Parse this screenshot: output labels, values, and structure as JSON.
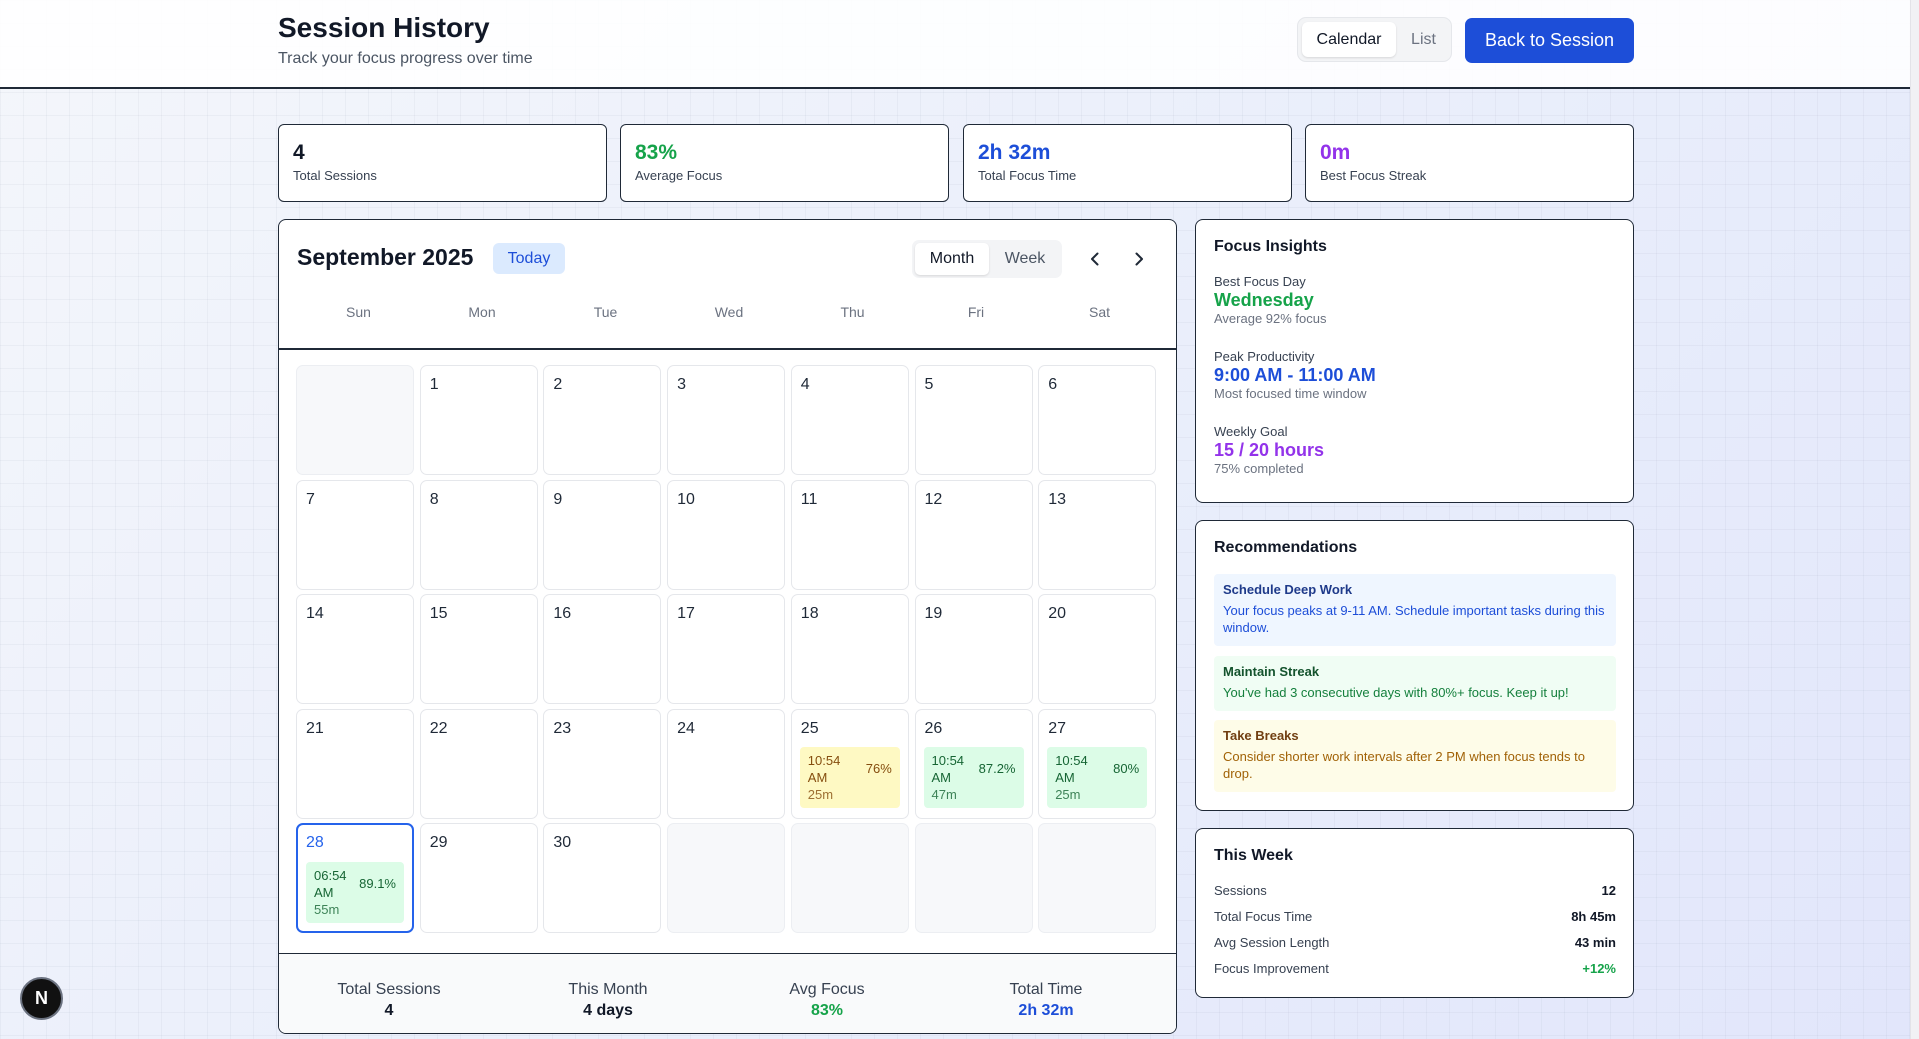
{
  "header": {
    "title": "Session History",
    "subtitle": "Track your focus progress over time",
    "view_toggle": {
      "calendar": "Calendar",
      "list": "List"
    },
    "back_button": "Back to Session"
  },
  "stats": [
    {
      "value": "4",
      "label": "Total Sessions",
      "color": "#111827"
    },
    {
      "value": "83%",
      "label": "Average Focus",
      "color": "#16a34a"
    },
    {
      "value": "2h 32m",
      "label": "Total Focus Time",
      "color": "#1d4ed8"
    },
    {
      "value": "0m",
      "label": "Best Focus Streak",
      "color": "#9333ea"
    }
  ],
  "calendar": {
    "month_title": "September 2025",
    "today_button": "Today",
    "view_month": "Month",
    "view_week": "Week",
    "weekdays": [
      "Sun",
      "Mon",
      "Tue",
      "Wed",
      "Thu",
      "Fri",
      "Sat"
    ],
    "leading_empty": 1,
    "days_in_month": 30,
    "today": 28,
    "sessions": {
      "25": {
        "time": "10:54 AM",
        "pct": "76%",
        "dur": "25m",
        "level": "mid"
      },
      "26": {
        "time": "10:54 AM",
        "pct": "87.2%",
        "dur": "47m",
        "level": "good"
      },
      "27": {
        "time": "10:54 AM",
        "pct": "80%",
        "dur": "25m",
        "level": "good"
      },
      "28": {
        "time": "06:54 AM",
        "pct": "89.1%",
        "dur": "55m",
        "level": "good"
      }
    },
    "footer": [
      {
        "label": "Total Sessions",
        "value": "4",
        "color": "#111827"
      },
      {
        "label": "This Month",
        "value": "4 days",
        "color": "#111827"
      },
      {
        "label": "Avg Focus",
        "value": "83%",
        "color": "#16a34a"
      },
      {
        "label": "Total Time",
        "value": "2h 32m",
        "color": "#1d4ed8"
      }
    ]
  },
  "insights": {
    "title": "Focus Insights",
    "items": [
      {
        "label": "Best Focus Day",
        "value": "Wednesday",
        "sub": "Average 92% focus",
        "color": "#16a34a"
      },
      {
        "label": "Peak Productivity",
        "value": "9:00 AM - 11:00 AM",
        "sub": "Most focused time window",
        "color": "#1d4ed8"
      },
      {
        "label": "Weekly Goal",
        "value": "15 / 20 hours",
        "sub": "75% completed",
        "color": "#9333ea"
      }
    ]
  },
  "recommendations": {
    "title": "Recommendations",
    "items": [
      {
        "title": "Schedule Deep Work",
        "text": "Your focus peaks at 9-11 AM. Schedule important tasks during this window.",
        "bg": "#eff6ff",
        "title_color": "#1e3a8a",
        "text_color": "#1d4ed8"
      },
      {
        "title": "Maintain Streak",
        "text": "You've had 3 consecutive days with 80%+ focus. Keep it up!",
        "bg": "#f0fdf4",
        "title_color": "#14532d",
        "text_color": "#15803d"
      },
      {
        "title": "Take Breaks",
        "text": "Consider shorter work intervals after 2 PM when focus tends to drop.",
        "bg": "#fefce8",
        "title_color": "#713f12",
        "text_color": "#a16207"
      }
    ]
  },
  "this_week": {
    "title": "This Week",
    "rows": [
      {
        "label": "Sessions",
        "value": "12",
        "color": "#111827"
      },
      {
        "label": "Total Focus Time",
        "value": "8h 45m",
        "color": "#111827"
      },
      {
        "label": "Avg Session Length",
        "value": "43 min",
        "color": "#111827"
      },
      {
        "label": "Focus Improvement",
        "value": "+12%",
        "color": "#16a34a"
      }
    ]
  },
  "badge": {
    "letter": "N"
  }
}
